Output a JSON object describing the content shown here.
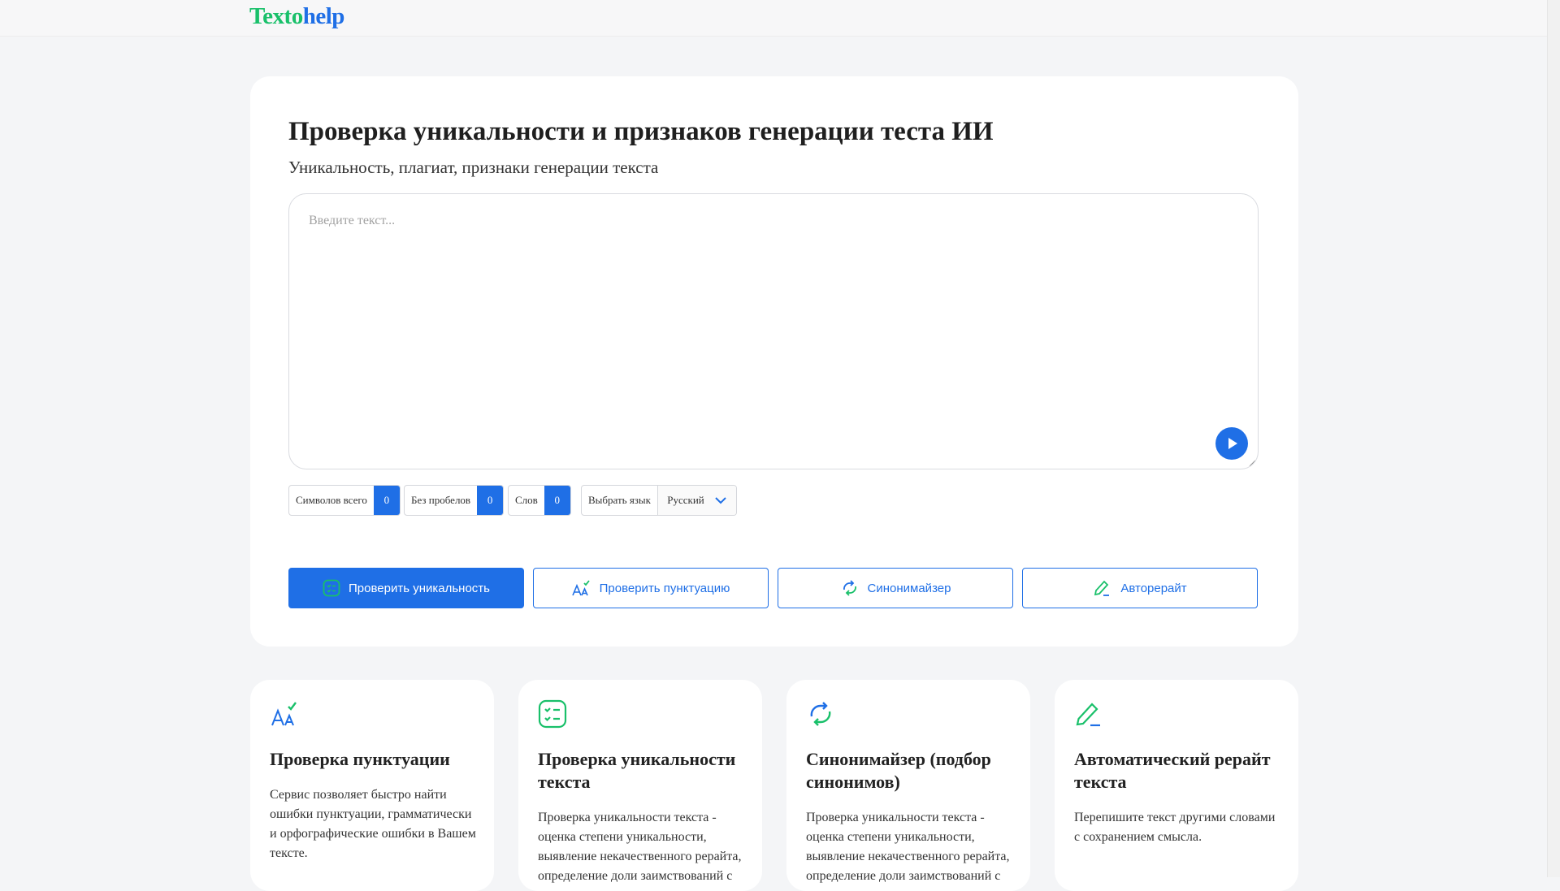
{
  "logo": {
    "part1": "Texto",
    "part2": "help"
  },
  "page": {
    "title": "Проверка уникальности и признаков генерации теста ИИ",
    "subtitle": "Уникальность, плагиат, признаки генерации текста"
  },
  "editor": {
    "placeholder": "Введите текст...",
    "value": ""
  },
  "counters": [
    {
      "label": "Символов всего",
      "value": "0"
    },
    {
      "label": "Без пробелов",
      "value": "0"
    },
    {
      "label": "Слов",
      "value": "0"
    }
  ],
  "language": {
    "label": "Выбрать язык",
    "selected": "Русский"
  },
  "actions": [
    {
      "label": "Проверить уникальность",
      "icon": "checklist-icon"
    },
    {
      "label": "Проверить пунктуацию",
      "icon": "spellcheck-icon"
    },
    {
      "label": "Синонимайзер",
      "icon": "refresh-arrows-icon"
    },
    {
      "label": "Авторерайт",
      "icon": "pencil-icon"
    }
  ],
  "features": [
    {
      "title": "Проверка пунктуации",
      "text": "Сервис позволяет быстро найти ошибки пунктуации, грамматически и орфографические ошибки в Вашем тексте.",
      "icon": "spellcheck-icon"
    },
    {
      "title": "Проверка уникальности текста",
      "text": "Проверка уникальности текста - оценка степени уникальности, выявление некачественного рерайта, определение доли заимствований с",
      "icon": "checklist-icon"
    },
    {
      "title": "Синонимайзер (подбор синонимов)",
      "text": "Проверка уникальности текста - оценка степени уникальности, выявление некачественного рерайта, определение доли заимствований с",
      "icon": "refresh-arrows-icon"
    },
    {
      "title": "Автоматический рерайт текста",
      "text": "Перепишите текст другими словами с сохранением смысла.",
      "icon": "pencil-icon"
    }
  ],
  "colors": {
    "brand_green": "#19c06a",
    "brand_blue": "#1f6fe6"
  }
}
